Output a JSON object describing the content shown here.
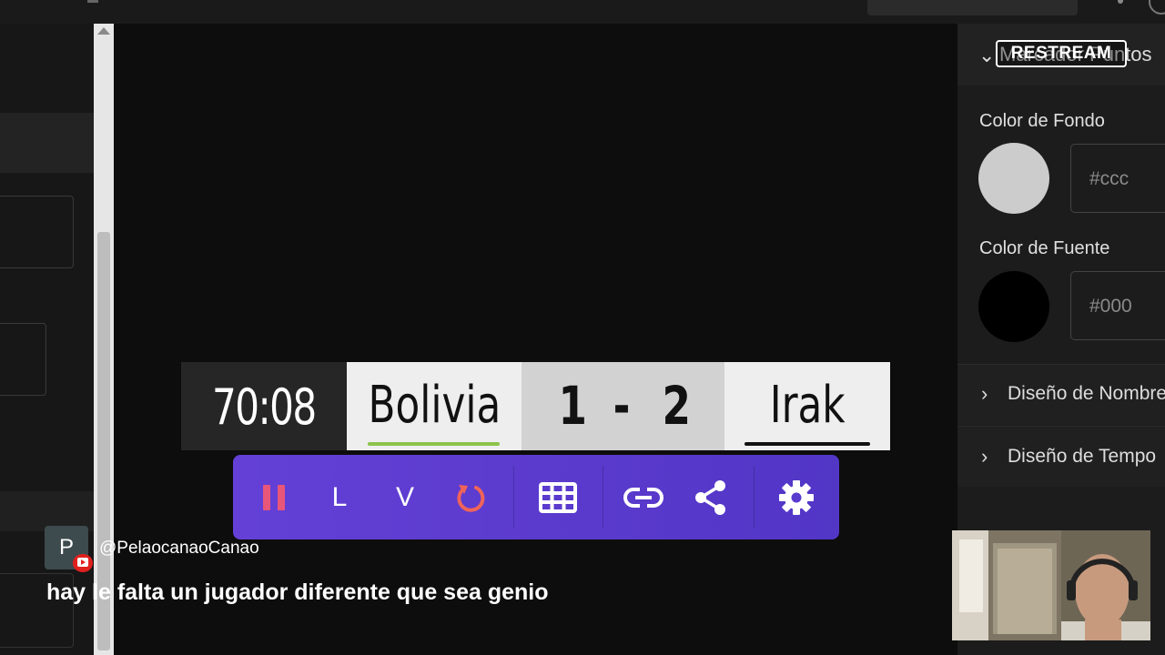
{
  "overlay": {
    "brand": "RESTREAM"
  },
  "right_panel": {
    "section_title": "Marcador Puntos",
    "background_color": {
      "label": "Color de Fondo",
      "value": "#ccc",
      "swatch": "#cccccc"
    },
    "font_color": {
      "label": "Color de Fuente",
      "value": "#000",
      "swatch": "#000000"
    },
    "collapsed_sections": [
      "Diseño de Nombres",
      "Diseño de Tempo"
    ]
  },
  "scoreboard": {
    "clock": "70:08",
    "home_team": "Bolivia",
    "away_team": "Irak",
    "home_score": "1",
    "separator": "-",
    "away_score": "2",
    "home_color": "#8bc34a",
    "away_color": "#111111"
  },
  "controls": {
    "pause_icon": "pause-icon",
    "local_label": "L",
    "visitor_label": "V",
    "reset_icon": "refresh-icon",
    "grid_icon": "grid-icon",
    "link_icon": "link-icon",
    "share_icon": "share-icon",
    "settings_icon": "gear-icon",
    "accent": "#5a3bd0"
  },
  "chat": {
    "avatar_initial": "P",
    "platform_icon": "youtube-icon",
    "username": "@PelaocanaoCanao",
    "message": "hay le falta un jugador diferente que sea genio"
  }
}
